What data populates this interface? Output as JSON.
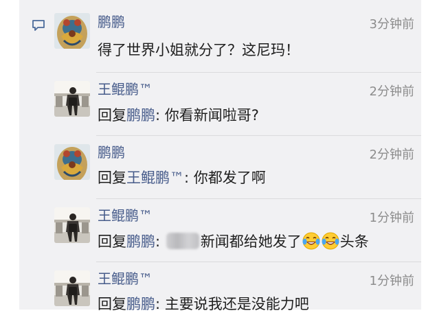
{
  "comments": [
    {
      "name": "鹏鹏",
      "time": "3分钟前",
      "text": "得了世界小姐就分了？这尼玛！",
      "avatar": "tattoo-back-avatar"
    },
    {
      "name": "王鲲鹏™",
      "time": "2分钟前",
      "reply_prefix": "回复",
      "reply_to": "鹏鹏",
      "text": ": 你看新闻啦哥?",
      "avatar": "walking-person-avatar"
    },
    {
      "name": "鹏鹏",
      "time": "2分钟前",
      "reply_prefix": "回复",
      "reply_to": "王鲲鹏™",
      "text": ": 你都发了啊",
      "avatar": "tattoo-back-avatar"
    },
    {
      "name": "王鲲鹏™",
      "time": "1分钟前",
      "reply_prefix": "回复",
      "reply_to": "鹏鹏",
      "text_before": ": ",
      "text": "新闻都给她发了",
      "text_after": "头条",
      "emojis": [
        "tears-of-joy-emoji",
        "tears-of-joy-emoji"
      ],
      "avatar": "walking-person-avatar"
    },
    {
      "name": "王鲲鹏™",
      "time": "1分钟前",
      "reply_prefix": "回复",
      "reply_to": "鹏鹏",
      "text": ": 主要说我还是没能力吧",
      "avatar": "walking-person-avatar"
    }
  ],
  "colors": {
    "name": "#465b8a",
    "time": "#8c8c8c",
    "text": "#1e1e1e",
    "background": "#f1f1f3"
  }
}
